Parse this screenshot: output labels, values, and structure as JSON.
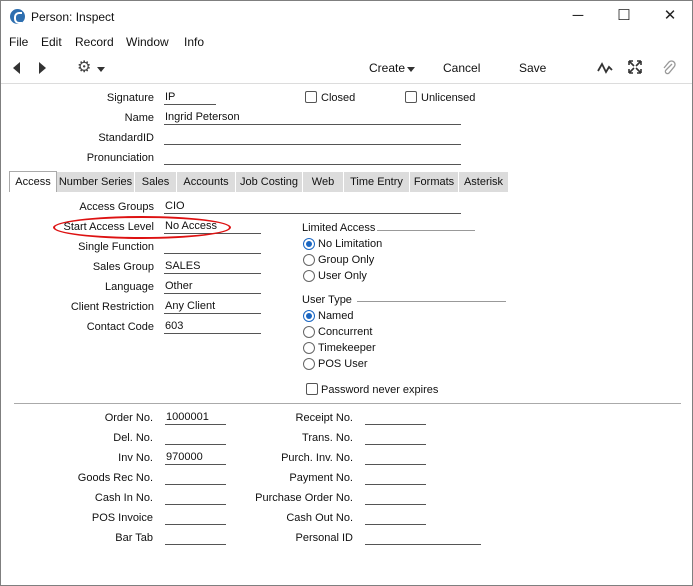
{
  "window": {
    "title": "Person: Inspect",
    "minimize_glyph": "─",
    "maximize_glyph": "☐",
    "close_glyph": "✕"
  },
  "menu": [
    "File",
    "Edit",
    "Record",
    "Window",
    "Info"
  ],
  "toolbar": {
    "create": "Create",
    "cancel": "Cancel",
    "save": "Save",
    "icons": [
      "back-arrow-icon",
      "forward-arrow-icon",
      "gear-icon",
      "activity-icon",
      "expand-icon",
      "paperclip-icon"
    ]
  },
  "header": {
    "signature_label": "Signature",
    "signature": "IP",
    "closed_label": "Closed",
    "unlicensed_label": "Unlicensed",
    "name_label": "Name",
    "name": "Ingrid Peterson",
    "standardid_label": "StandardID",
    "standardid": "",
    "pronunciation_label": "Pronunciation",
    "pronunciation": ""
  },
  "tabs": [
    "Access",
    "Number Series",
    "Sales",
    "Accounts",
    "Job Costing",
    "Web",
    "Time Entry",
    "Formats",
    "Asterisk"
  ],
  "access": {
    "access_groups_label": "Access Groups",
    "access_groups": "CIO",
    "start_access_level_label": "Start Access Level",
    "start_access_level": "No Access",
    "single_function_label": "Single Function",
    "single_function": "",
    "sales_group_label": "Sales Group",
    "sales_group": "SALES",
    "language_label": "Language",
    "language": "Other",
    "client_restriction_label": "Client Restriction",
    "client_restriction": "Any Client",
    "contact_code_label": "Contact Code",
    "contact_code": "603",
    "limited_access_title": "Limited Access",
    "limited_access_options": [
      "No Limitation",
      "Group Only",
      "User Only"
    ],
    "limited_access_selected": "No Limitation",
    "user_type_title": "User Type",
    "user_type_options": [
      "Named",
      "Concurrent",
      "Timekeeper",
      "POS User"
    ],
    "user_type_selected": "Named",
    "password_never_expires_label": "Password never expires"
  },
  "numbers": {
    "order_no_label": "Order No.",
    "order_no": "1000001",
    "del_no_label": "Del. No.",
    "del_no": "",
    "inv_no_label": "Inv No.",
    "inv_no": "970000",
    "goods_rec_no_label": "Goods Rec No.",
    "goods_rec_no": "",
    "cash_in_no_label": "Cash In No.",
    "cash_in_no": "",
    "pos_invoice_label": "POS Invoice",
    "pos_invoice": "",
    "bar_tab_label": "Bar Tab",
    "bar_tab": "",
    "receipt_no_label": "Receipt No.",
    "receipt_no": "",
    "trans_no_label": "Trans. No.",
    "trans_no": "",
    "purch_inv_no_label": "Purch. Inv. No.",
    "purch_inv_no": "",
    "payment_no_label": "Payment No.",
    "payment_no": "",
    "purchase_order_no_label": "Purchase Order No.",
    "purchase_order_no": "",
    "cash_out_no_label": "Cash Out No.",
    "cash_out_no": "",
    "personal_id_label": "Personal ID",
    "personal_id": ""
  },
  "colors": {
    "highlight_oval": "#dd1111",
    "radio_selected": "#1a66c2"
  }
}
